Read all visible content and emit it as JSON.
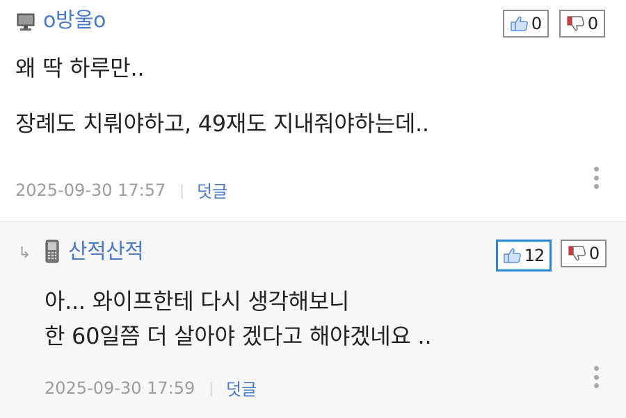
{
  "comments": [
    {
      "nickname": "o방울o",
      "device_icon": "pc-monitor-icon",
      "likes": "0",
      "dislikes": "0",
      "body": "왜 딱 하루만..\n\n장례도 치뤄야하고, 49재도 지내줘야하는데..",
      "timestamp": "2025-09-30 17:57",
      "separator": "|",
      "reply_label": "덧글"
    },
    {
      "nickname": "산적산적",
      "device_icon": "mobile-phone-icon",
      "reply_marker": "↳",
      "likes": "12",
      "dislikes": "0",
      "body": "아... 와이프한테 다시 생각해보니\n한 60일쯤 더 살아야 겠다고 해야겠네요 ..",
      "timestamp": "2025-09-30 17:59",
      "separator": "|",
      "reply_label": "덧글"
    }
  ],
  "colors": {
    "nickname": "#4a79c6",
    "active_vote_border": "#2b87d3",
    "thumb_up": "#5b8fd6",
    "thumb_down": "#d33b3b"
  }
}
